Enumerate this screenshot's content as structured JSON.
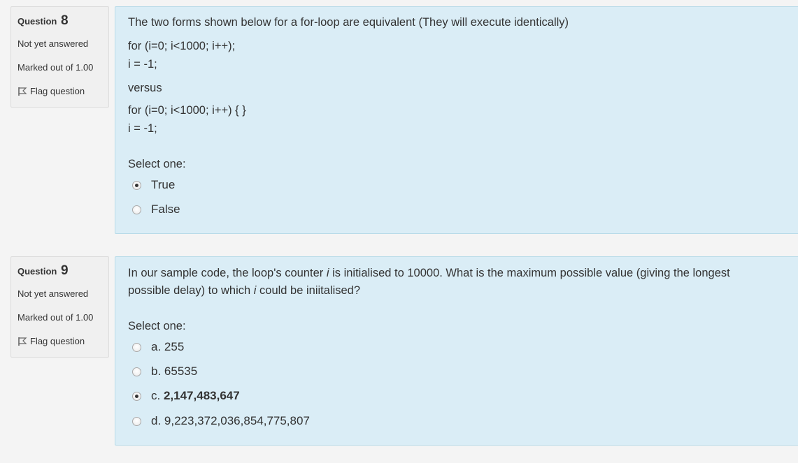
{
  "questions": [
    {
      "label": "Question",
      "number": "8",
      "state": "Not yet answered",
      "grade": "Marked out of 1.00",
      "flag": "Flag question",
      "text_lines": [
        "The two forms shown below for a for-loop are equivalent (They will execute identically)",
        "for (i=0; i<1000; i++);",
        "i = -1;",
        "versus",
        "for (i=0; i<1000; i++) { }",
        "i = -1;"
      ],
      "prompt": "Select one:",
      "options": [
        {
          "label": "True",
          "selected": true
        },
        {
          "label": "False",
          "selected": false
        }
      ]
    },
    {
      "label": "Question",
      "number": "9",
      "state": "Not yet answered",
      "grade": "Marked out of 1.00",
      "flag": "Flag question",
      "text_parts": {
        "line1_a": "In our sample code, the loop's counter ",
        "line1_var": "i",
        "line1_b": " is initialised to 10000.  What is the maximum possible value (giving the longest",
        "line2_a": "possible delay) to which ",
        "line2_var": "i",
        "line2_b": " could be iniitalised?"
      },
      "prompt": "Select one:",
      "options": [
        {
          "prefix": "a.",
          "label": "255",
          "selected": false
        },
        {
          "prefix": "b.",
          "label": "65535",
          "selected": false
        },
        {
          "prefix": "c.",
          "label": "2,147,483,647",
          "selected": true
        },
        {
          "prefix": "d.",
          "label": "9,223,372,036,854,775,807",
          "selected": false
        }
      ]
    }
  ]
}
